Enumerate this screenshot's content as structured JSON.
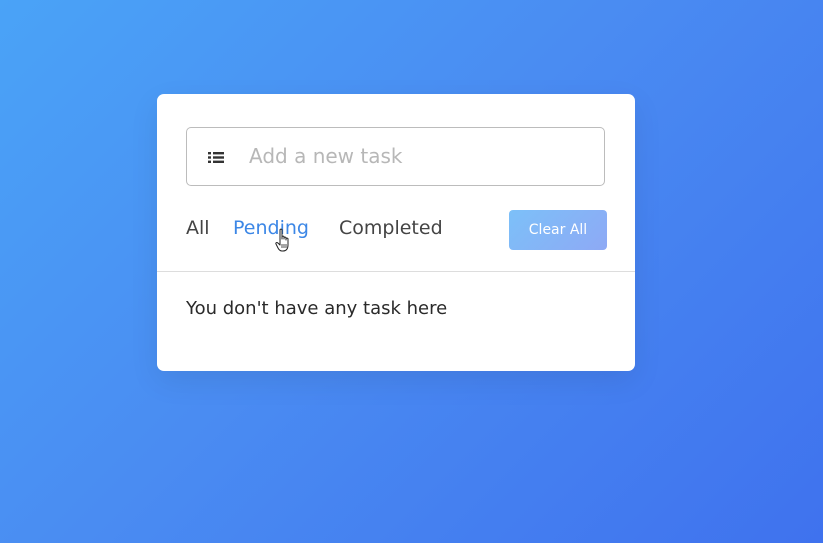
{
  "task_input": {
    "placeholder": "Add a new task",
    "value": "",
    "icon": "list-icon"
  },
  "filters": {
    "all": "All",
    "pending": "Pending",
    "completed": "Completed",
    "active": "pending"
  },
  "clear_button": {
    "label": "Clear All"
  },
  "task_list": {
    "empty_message": "You don't have any task here"
  },
  "colors": {
    "background_start": "#4aa3f7",
    "background_end": "#3f72ee",
    "active_filter": "#3c87e6",
    "button_start": "#7cc0f8",
    "button_end": "#8ea9f5"
  },
  "cursor": {
    "icon": "hand-pointer-icon"
  }
}
